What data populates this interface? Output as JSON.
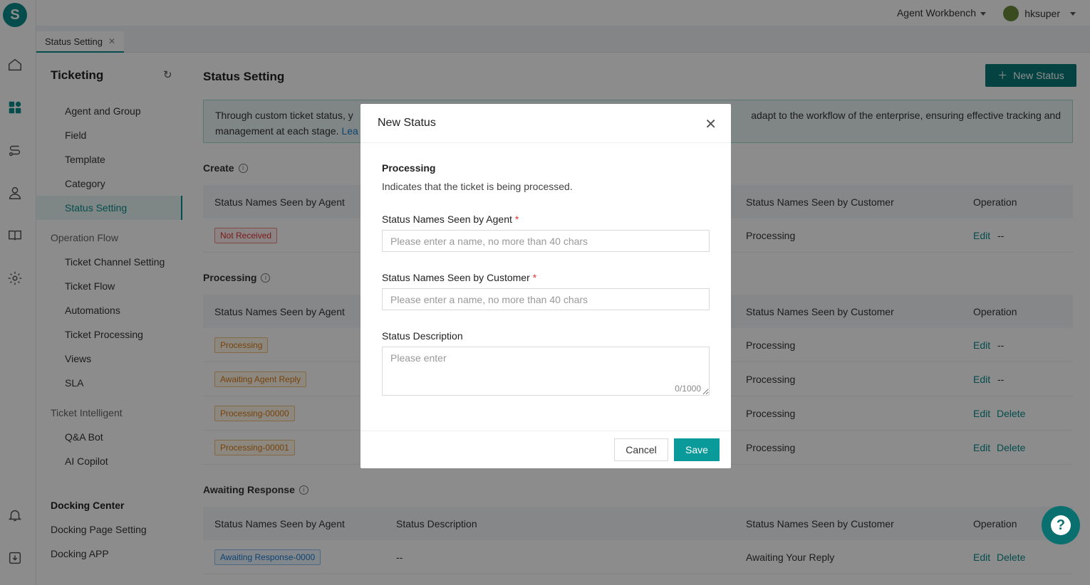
{
  "rail": {
    "logo_letter": "S"
  },
  "topbar": {
    "workbench": "Agent Workbench",
    "username": "hksuper"
  },
  "tab": {
    "label": "Status Setting",
    "close": "✕"
  },
  "menu": {
    "title": "Ticketing",
    "items_1": [
      "Agent and Group",
      "Field",
      "Template",
      "Category",
      "Status Setting"
    ],
    "group_operation": "Operation Flow",
    "items_2": [
      "Ticket Channel Setting",
      "Ticket Flow",
      "Automations",
      "Ticket Processing",
      "Views",
      "SLA"
    ],
    "group_intelligent": "Ticket Intelligent",
    "items_3": [
      "Q&A Bot",
      "AI Copilot"
    ],
    "group_docking": "Docking Center",
    "items_4": [
      "Docking Page Setting",
      "Docking APP"
    ]
  },
  "main": {
    "title": "Status Setting",
    "new_button": "New Status",
    "alert_left": "Through custom ticket status, y",
    "alert_right": "adapt to the workflow of the enterprise, ensuring effective tracking and",
    "alert_line2": "management at each stage.",
    "alert_link": "Lea",
    "columns": {
      "agent": "Status Names Seen by Agent",
      "description": "Status Description",
      "customer": "Status Names Seen by Customer",
      "operation": "Operation"
    },
    "sections": {
      "create": "Create",
      "processing": "Processing",
      "awaiting": "Awaiting Response"
    },
    "rows_create": [
      {
        "tag": "Not Received",
        "customer": "Processing",
        "op1": "Edit",
        "op2": "--"
      }
    ],
    "rows_processing": [
      {
        "tag": "Processing",
        "customer": "Processing",
        "op1": "Edit",
        "op2": "--"
      },
      {
        "tag": "Awaiting Agent Reply",
        "customer": "Processing",
        "op1": "Edit",
        "op2": "--"
      },
      {
        "tag": "Processing-00000",
        "customer": "Processing",
        "op1": "Edit",
        "op2": "Delete"
      },
      {
        "tag": "Processing-00001",
        "customer": "Processing",
        "op1": "Edit",
        "op2": "Delete"
      }
    ],
    "rows_awaiting": [
      {
        "tag": "Awaiting Response-0000",
        "description": "--",
        "customer": "Awaiting Your Reply",
        "op1": "Edit",
        "op2": "Delete"
      }
    ]
  },
  "modal": {
    "title": "New Status",
    "close": "✕",
    "category": "Processing",
    "category_desc": "Indicates that the ticket is being processed.",
    "agent_label": "Status Names Seen by Agent",
    "agent_placeholder": "Please enter a name, no more than 40 chars",
    "customer_label": "Status Names Seen by Customer",
    "customer_placeholder": "Please enter a name, no more than 40 chars",
    "desc_label": "Status Description",
    "desc_placeholder": "Please enter",
    "counter": "0/1000",
    "required": "*",
    "cancel": "Cancel",
    "save": "Save"
  },
  "colors": {
    "accent": "#0a8c8c",
    "primary_button": "#0a7a7a",
    "required": "#e33333"
  }
}
